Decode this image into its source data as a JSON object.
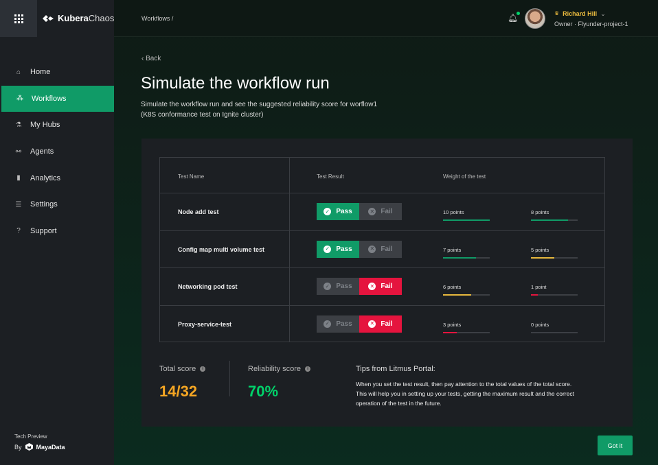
{
  "app": {
    "logo_bold": "Kubera",
    "logo_light": "Chaos"
  },
  "sidebar": {
    "items": [
      {
        "label": "Home",
        "icon": "⌂"
      },
      {
        "label": "Workflows",
        "icon": "⁂"
      },
      {
        "label": "My Hubs",
        "icon": "⚗"
      },
      {
        "label": "Agents",
        "icon": "⚯"
      },
      {
        "label": "Analytics",
        "icon": "▮"
      },
      {
        "label": "Settings",
        "icon": "☰"
      },
      {
        "label": "Support",
        "icon": "?"
      }
    ],
    "tech_preview": "Tech Preview",
    "by": "By",
    "maker": "MayaData"
  },
  "header": {
    "breadcrumb": "Workflows  /",
    "user_name": "Richard Hill",
    "user_role": "Owner · Flyunder-project-1"
  },
  "page": {
    "back": "Back",
    "title": "Simulate the workflow run",
    "subtitle": "Simulate the workflow run and see the suggested reliability score for worflow1 (K8S conformance test on Ignite cluster)"
  },
  "table": {
    "headers": {
      "name": "Test Name",
      "result": "Test Result",
      "weight": "Weight of the test"
    },
    "pass_label": "Pass",
    "fail_label": "Fail",
    "rows": [
      {
        "name": "Node add test",
        "result": "pass",
        "weight": "10 points",
        "weight_fraction": 1.0,
        "weight_color": "#109b67",
        "score": "8 points",
        "score_fraction": 0.8,
        "score_color": "#109b67"
      },
      {
        "name": "Config map multi volume test",
        "result": "pass",
        "weight": "7 points",
        "weight_fraction": 0.7,
        "weight_color": "#109b67",
        "score": "5 points",
        "score_fraction": 0.5,
        "score_color": "#e8b93e"
      },
      {
        "name": "Networking pod test",
        "result": "fail",
        "weight": "6 points",
        "weight_fraction": 0.6,
        "weight_color": "#e8b93e",
        "score": "1 point",
        "score_fraction": 0.15,
        "score_color": "#e5143e"
      },
      {
        "name": "Proxy-service-test",
        "result": "fail",
        "weight": "3 points",
        "weight_fraction": 0.3,
        "weight_color": "#e5143e",
        "score": "0 points",
        "score_fraction": 0.0,
        "score_color": "#e5143e"
      }
    ]
  },
  "scores": {
    "total_label": "Total score",
    "total_value": "14/32",
    "total_color": "#f5a623",
    "reliability_label": "Reliability score",
    "reliability_value": "70%",
    "reliability_color": "#00d26a"
  },
  "tips": {
    "title": "Tips from Litmus Portal:",
    "text": "When you set the test result, then pay attention to the total values of the total score. This will help you in setting up your tests, getting the maximum result and the correct operation of the test in the future."
  },
  "actions": {
    "got_it": "Got it"
  }
}
